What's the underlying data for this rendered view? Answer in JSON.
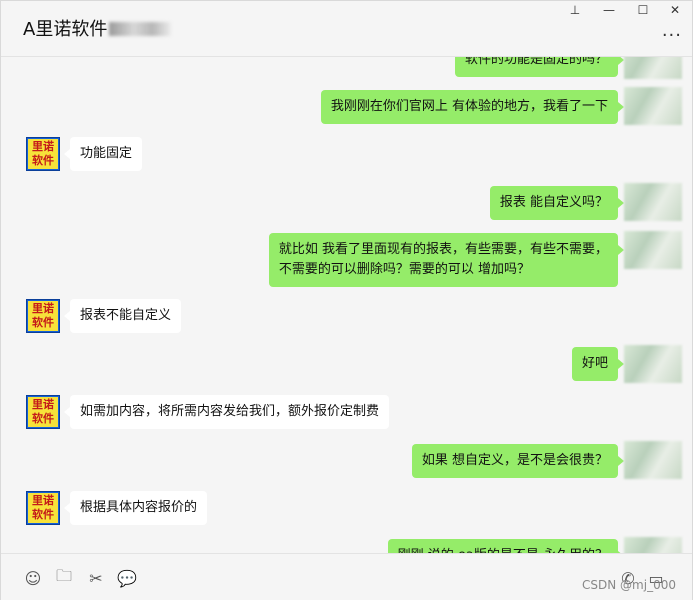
{
  "header": {
    "title": "A里诺软件",
    "pin": "⊥",
    "minimize": "—",
    "maximize": "☐",
    "close": "✕",
    "more": "···"
  },
  "logo": {
    "line1": "里诺",
    "line2": "软件"
  },
  "messages": [
    {
      "side": "me",
      "text": "软件的功能是固定的吗？"
    },
    {
      "side": "me",
      "text": "我刚刚在你们官网上 有体验的地方，我看了一下"
    },
    {
      "side": "other",
      "text": "功能固定"
    },
    {
      "side": "me",
      "text": "报表 能自定义吗？"
    },
    {
      "side": "me",
      "text": "就比如 我看了里面现有的报表，有些需要，有些不需要，",
      "text2": "不需要的可以删除吗？需要的可以 增加吗？"
    },
    {
      "side": "other",
      "text": "报表不能自定义"
    },
    {
      "side": "me",
      "text": "好吧"
    },
    {
      "side": "other",
      "text": "如需加内容，将所需内容发给我们，额外报价定制费"
    },
    {
      "side": "me",
      "text": "如果 想自定义，是不是会很贵？"
    },
    {
      "side": "other",
      "text": "根据具体内容报价的"
    },
    {
      "side": "me",
      "text": "刚刚 说的 ea版的是不是 永久用的？"
    }
  ],
  "toolbar": {
    "emoji": "☺",
    "folder": "🗀",
    "scissors": "✂",
    "chat": "💬",
    "phone": "✆",
    "video": "▭",
    "watermark": "CSDN @mj_000"
  }
}
